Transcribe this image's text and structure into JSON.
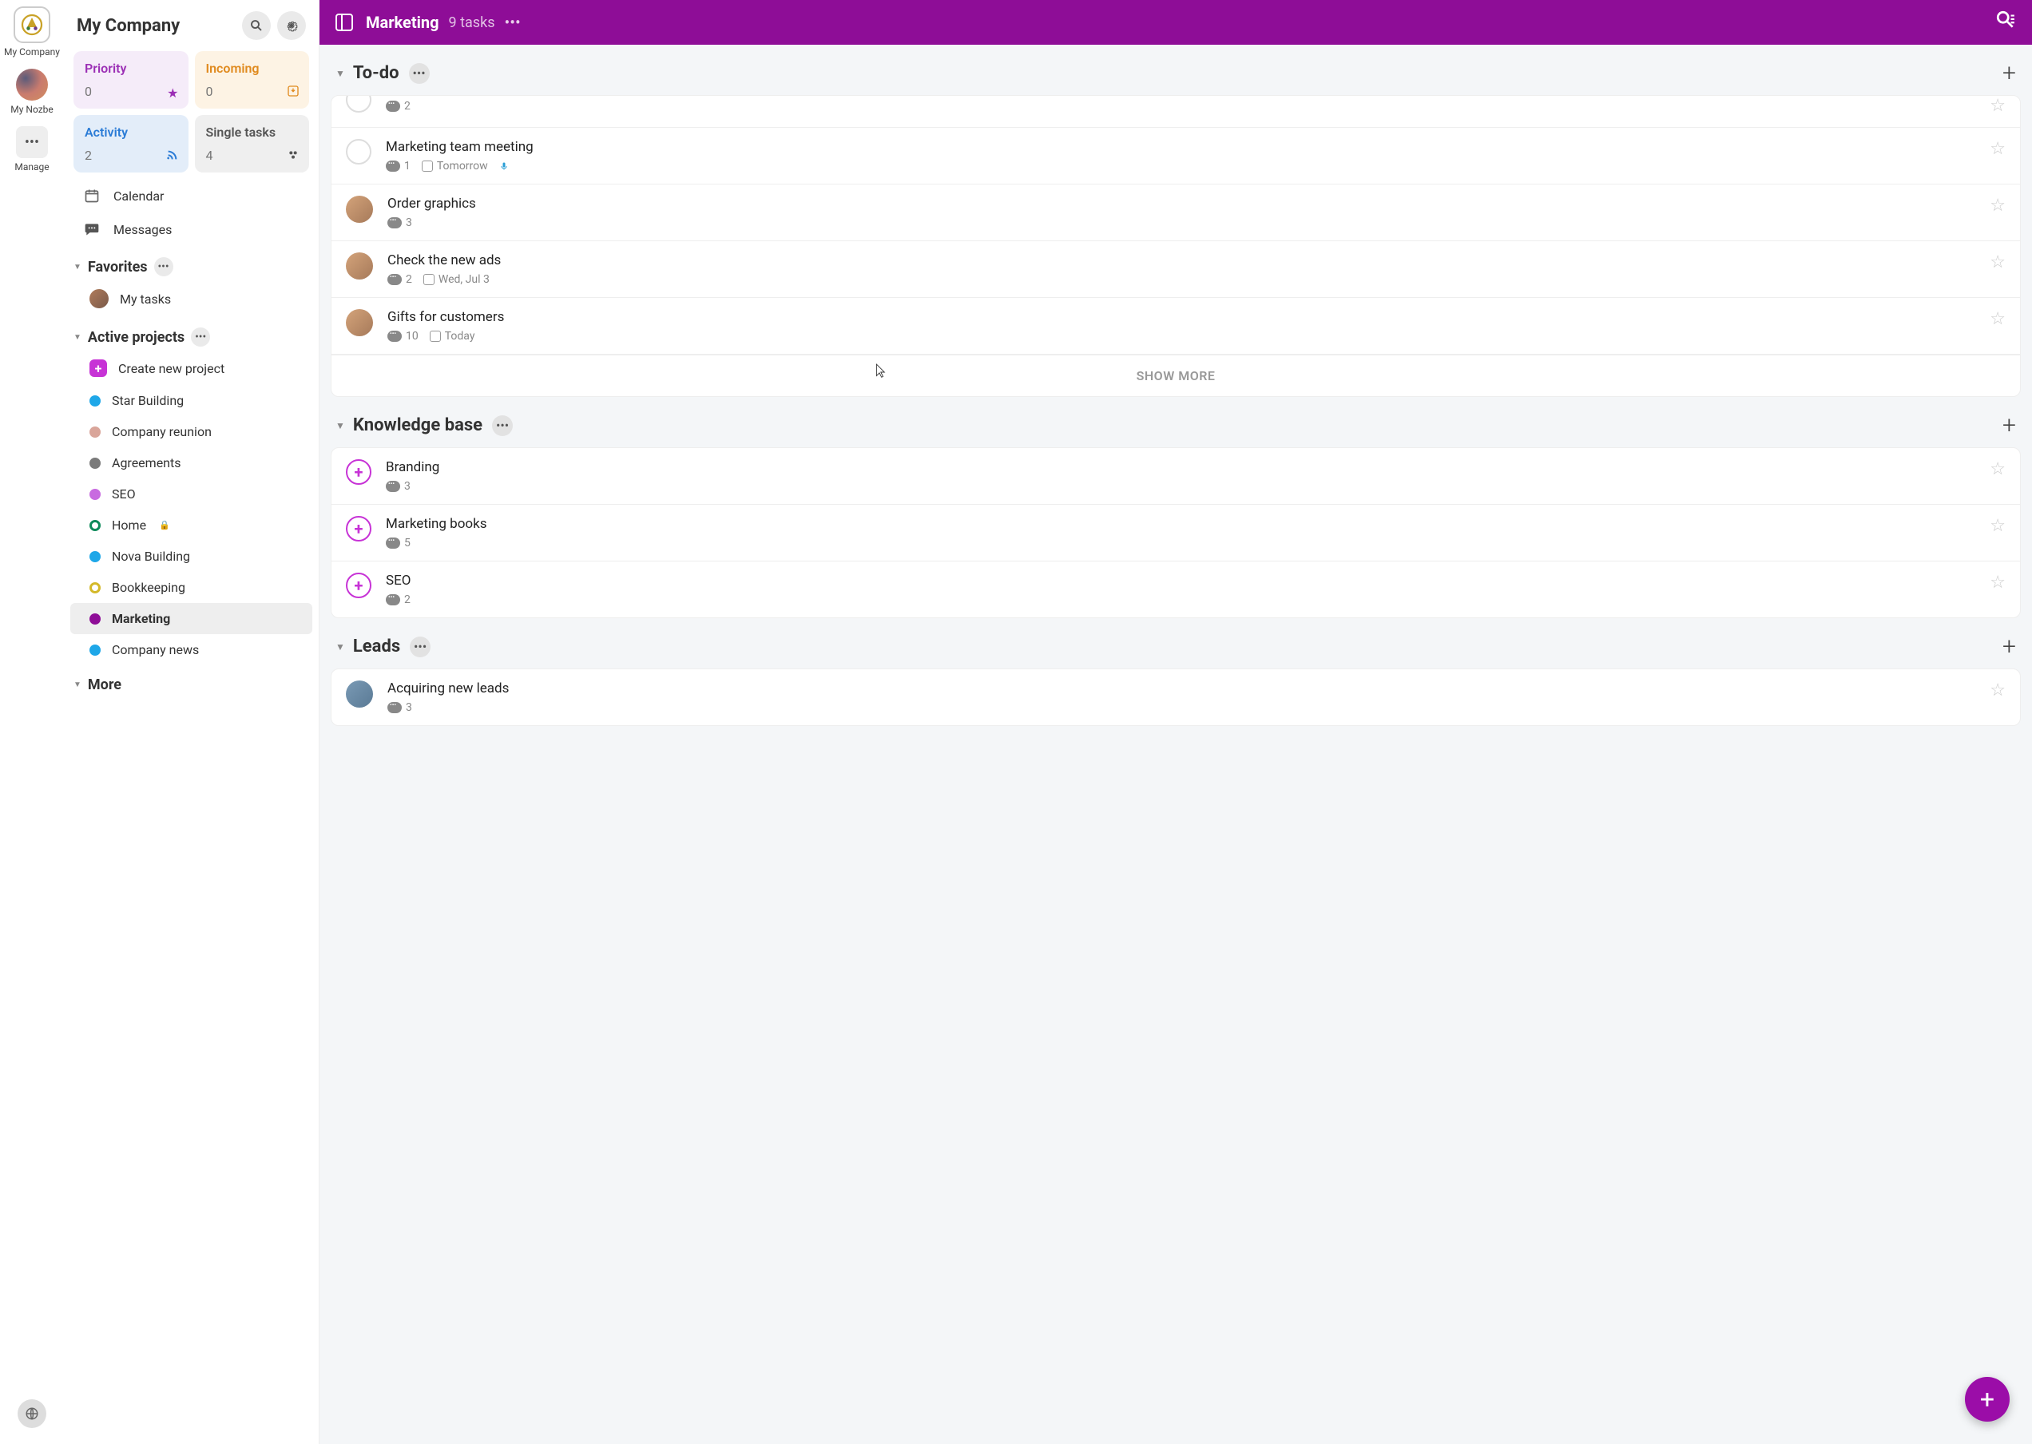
{
  "rail": {
    "company": "My Company",
    "nozbe": "My Nozbe",
    "manage": "Manage"
  },
  "sidebar": {
    "title": "My Company",
    "cards": {
      "priority": {
        "title": "Priority",
        "count": "0"
      },
      "incoming": {
        "title": "Incoming",
        "count": "0"
      },
      "activity": {
        "title": "Activity",
        "count": "2"
      },
      "single": {
        "title": "Single tasks",
        "count": "4"
      }
    },
    "calendar": "Calendar",
    "messages": "Messages",
    "favorites_hd": "Favorites",
    "my_tasks": "My tasks",
    "active_hd": "Active projects",
    "create_project": "Create new project",
    "projects": [
      {
        "label": "Star Building",
        "color": "#1ea7e8"
      },
      {
        "label": "Company reunion",
        "color": "#d9a59a"
      },
      {
        "label": "Agreements",
        "color": "#7a7a7a"
      },
      {
        "label": "SEO",
        "color": "#c86ae0"
      },
      {
        "label": "Home",
        "color": "#0e8a5a",
        "ring": true,
        "locked": true
      },
      {
        "label": "Nova Building",
        "color": "#1ea7e8"
      },
      {
        "label": "Bookkeeping",
        "color": "#d4b92a",
        "ring": true
      },
      {
        "label": "Marketing",
        "color": "#8e0d97",
        "active": true
      },
      {
        "label": "Company news",
        "color": "#1ea7e8"
      }
    ],
    "more_hd": "More"
  },
  "topbar": {
    "project": "Marketing",
    "count": "9 tasks"
  },
  "sections": [
    {
      "title": "To-do",
      "show_more": "SHOW MORE",
      "tasks": [
        {
          "title": "",
          "comments": "2",
          "check": "circle",
          "partial": true
        },
        {
          "title": "Marketing team meeting",
          "comments": "1",
          "date": "Tomorrow",
          "mic": true,
          "check": "circle"
        },
        {
          "title": "Order graphics",
          "comments": "3",
          "avatar": "f"
        },
        {
          "title": "Check the new ads",
          "comments": "2",
          "date": "Wed, Jul 3",
          "avatar": "f"
        },
        {
          "title": "Gifts for customers",
          "comments": "10",
          "date": "Today",
          "avatar": "f"
        }
      ]
    },
    {
      "title": "Knowledge base",
      "tasks": [
        {
          "title": "Branding",
          "comments": "3",
          "check": "plus"
        },
        {
          "title": "Marketing books",
          "comments": "5",
          "check": "plus"
        },
        {
          "title": "SEO",
          "comments": "2",
          "check": "plus"
        }
      ]
    },
    {
      "title": "Leads",
      "tasks": [
        {
          "title": "Acquiring new leads",
          "comments": "3",
          "avatar": "m"
        }
      ]
    }
  ]
}
